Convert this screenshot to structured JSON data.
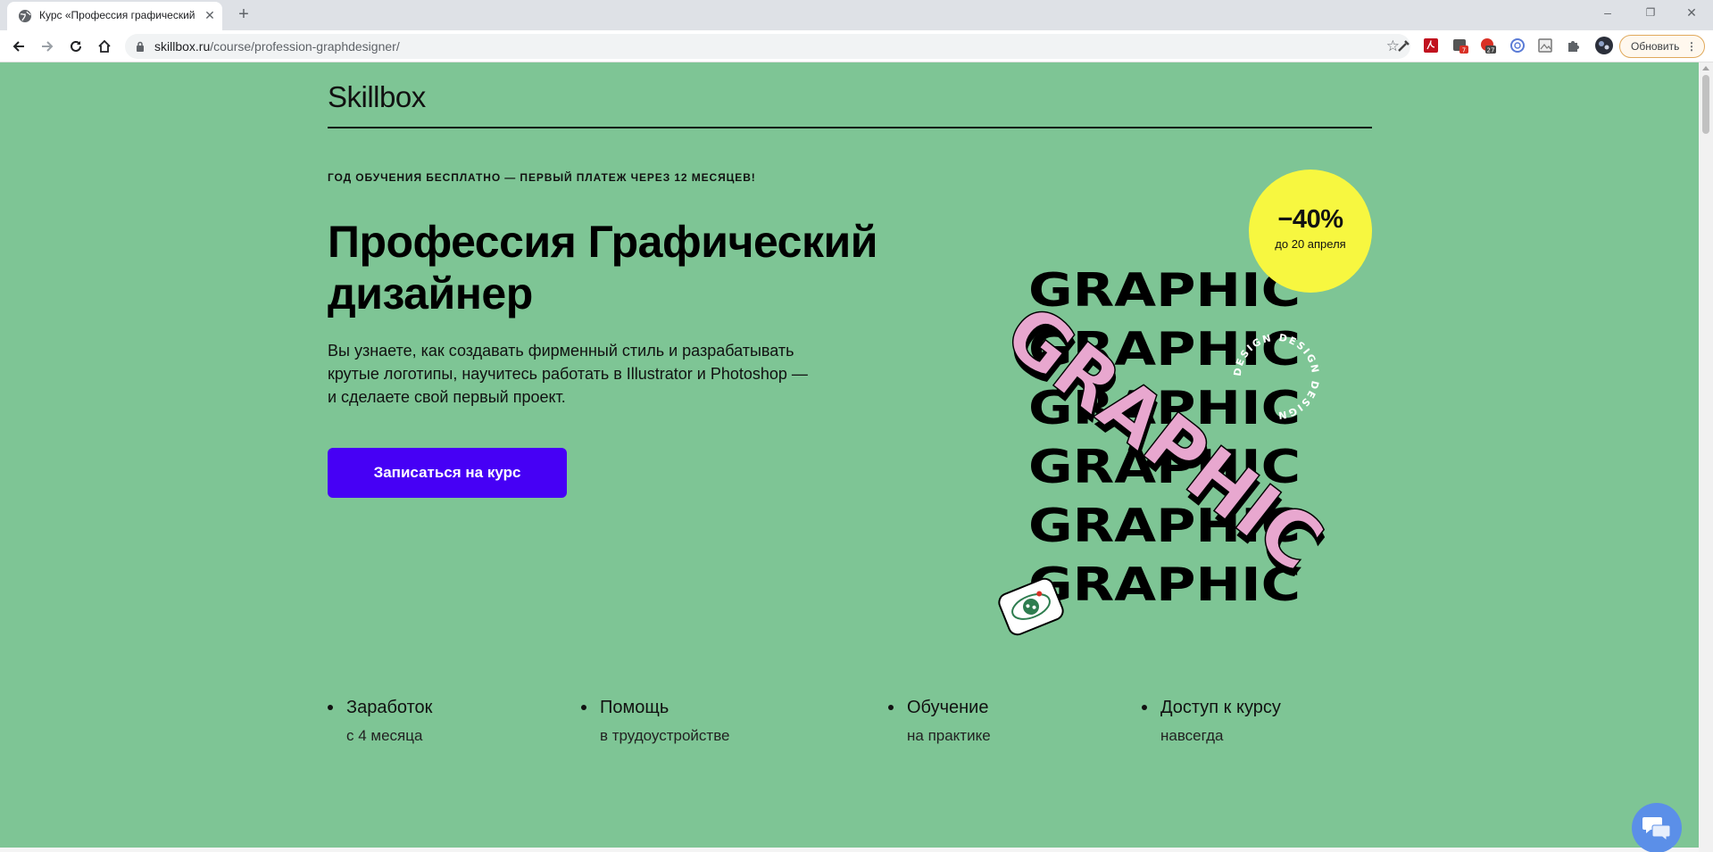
{
  "browser": {
    "tab_title": "Курс «Профессия графический",
    "tab_close": "✕",
    "new_tab": "+",
    "url_host": "skillbox.ru",
    "url_path": "/course/profession-graphdesigner/",
    "update_button": "Обновить",
    "update_menu": "⋮",
    "ext_badge_1": "7",
    "ext_badge_2": "27",
    "window_controls": [
      "–",
      "❐",
      "✕"
    ]
  },
  "header": {
    "logo": "Skillbox"
  },
  "hero": {
    "promo": "ГОД ОБУЧЕНИЯ БЕСПЛАТНО — ПЕРВЫЙ ПЛАТЕЖ ЧЕРЕЗ 12 МЕСЯЦЕВ!",
    "title_line1": "Профессия Графический",
    "title_line2": "дизайнер",
    "desc_line1": "Вы узнаете, как создавать фирменный стиль и разрабатывать",
    "desc_line2": "крутые логотипы, научитесь работать в Illustrator и Photoshop —",
    "desc_line3": "и сделаете свой первый проект.",
    "cta": "Записаться на курс"
  },
  "badge": {
    "discount": "−40%",
    "until": "до 20 апреля"
  },
  "art": {
    "stack_word": "GRAPHIC",
    "diagonal_word": "GRAPHIC",
    "ring_text": "DESIGN DESIGN DESIGN"
  },
  "features": [
    {
      "title": "Заработок",
      "sub": "с 4 месяца"
    },
    {
      "title": "Помощь",
      "sub": "в трудоустройстве"
    },
    {
      "title": "Обучение",
      "sub": "на практике"
    },
    {
      "title": "Доступ к курсу",
      "sub": "навсегда"
    }
  ],
  "colors": {
    "page_bg": "#7ec595",
    "cta_bg": "#4600f5",
    "badge_bg": "#f7f740",
    "art_pink": "#e8a7cf"
  }
}
